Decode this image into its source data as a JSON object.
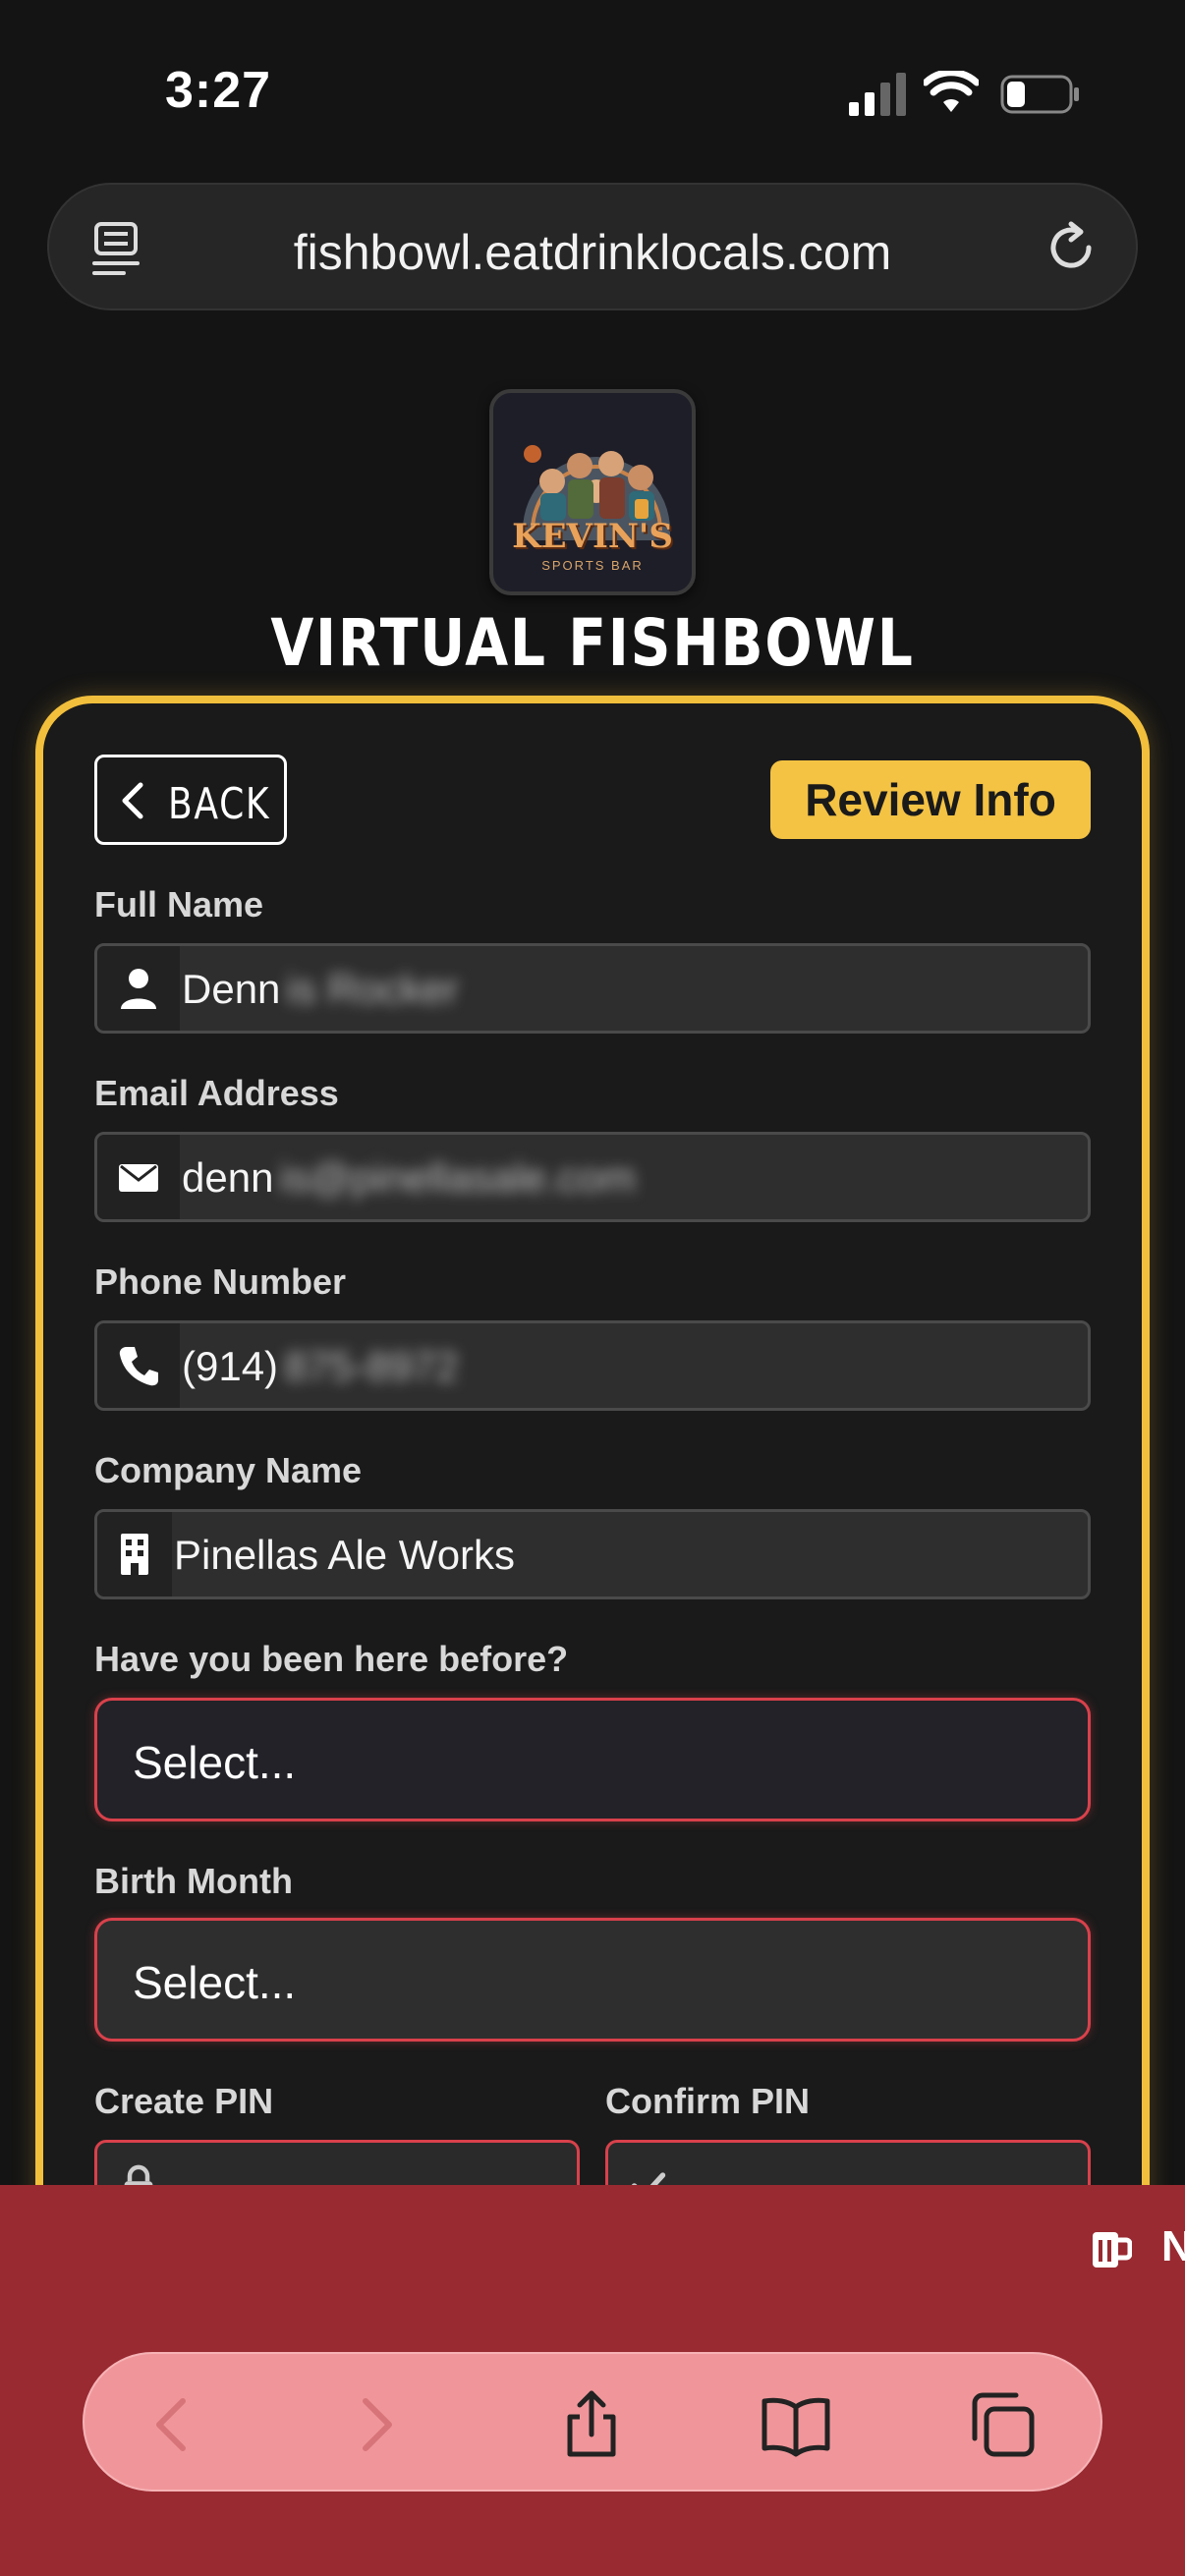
{
  "status_bar": {
    "time": "3:27"
  },
  "browser": {
    "url": "fishbowl.eatdrinklocals.com"
  },
  "logo": {
    "name": "KEVIN'S",
    "subtitle": "SPORTS BAR"
  },
  "page_title": "VIRTUAL FISHBOWL",
  "form": {
    "back_label": "BACK",
    "review_label": "Review Info",
    "full_name": {
      "label": "Full Name",
      "value": "Denn",
      "blurred": "is Rocker"
    },
    "email": {
      "label": "Email Address",
      "value": "denn",
      "blurred": "is@pinellasale.com"
    },
    "phone": {
      "label": "Phone Number",
      "value": "(914)",
      "blurred": "875-8972"
    },
    "company": {
      "label": "Company Name",
      "value": "Pinellas Ale Works"
    },
    "been_before": {
      "label": "Have you been here before?",
      "selected": "Select..."
    },
    "birth_month": {
      "label": "Birth Month",
      "selected": "Select..."
    },
    "create_pin": {
      "label": "Create PIN"
    },
    "confirm_pin": {
      "label": "Confirm PIN"
    }
  },
  "promo": {
    "text": "N"
  },
  "colors": {
    "accent": "#f4c344",
    "error": "#d9414b",
    "bottom_bar": "#992a31"
  }
}
